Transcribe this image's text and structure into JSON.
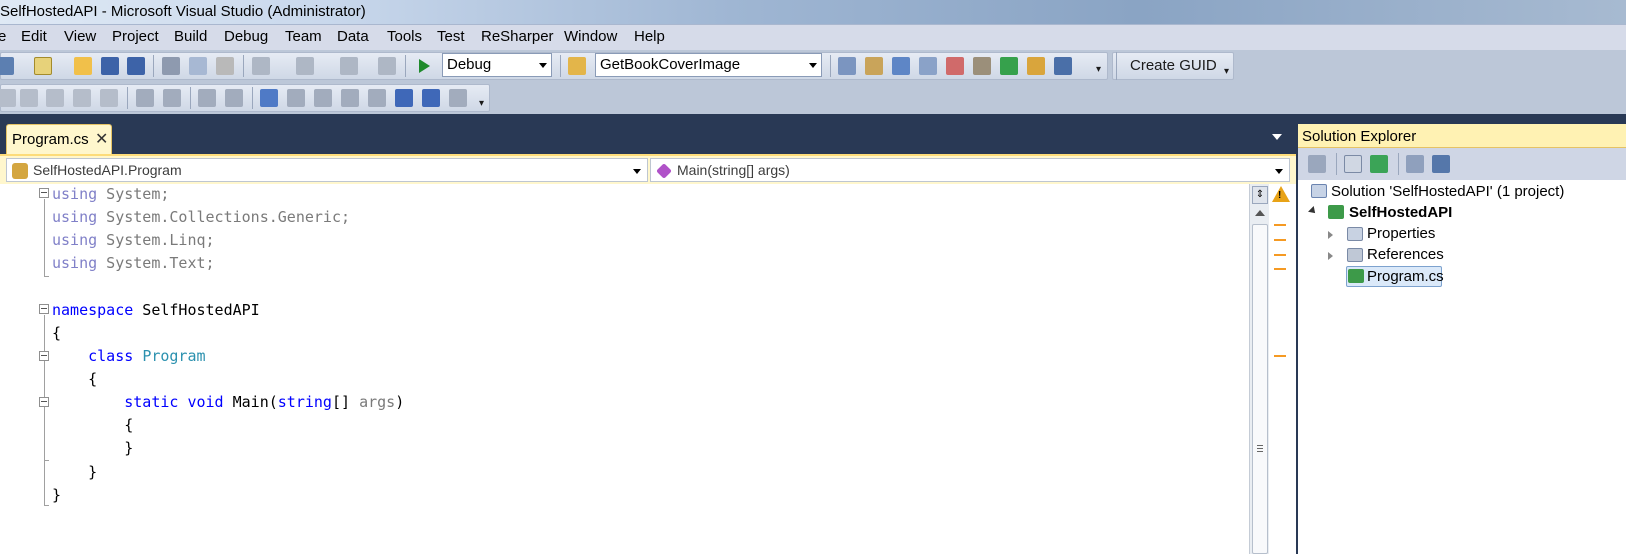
{
  "window": {
    "title": "SelfHostedAPI - Microsoft Visual Studio (Administrator)"
  },
  "menu": [
    "e",
    "Edit",
    "View",
    "Project",
    "Build",
    "Debug",
    "Team",
    "Data",
    "Tools",
    "Test",
    "ReSharper",
    "Window",
    "Help"
  ],
  "toolbar": {
    "configuration": "Debug",
    "find_combo": "GetBookCoverImage",
    "create_guid": "Create GUID"
  },
  "document": {
    "tab_label": "Program.cs",
    "tab_close": "✕"
  },
  "navbar": {
    "type_combo": "SelfHostedAPI.Program",
    "member_combo": "Main(string[] args)"
  },
  "code": {
    "l1_kw": "using",
    "l1_rest": " System;",
    "l2_kw": "using",
    "l2_rest": " System.Collections.Generic;",
    "l3_kw": "using",
    "l3_rest": " System.Linq;",
    "l4_kw": "using",
    "l4_rest": " System.Text;",
    "l6_kw": "namespace",
    "l6_rest": " SelfHostedAPI",
    "l7": "{",
    "l8_indent": "    ",
    "l8_kw": "class",
    "l8_sp": " ",
    "l8_type": "Program",
    "l9": "    {",
    "l10_indent": "        ",
    "l10_kw1": "static",
    "l10_sp1": " ",
    "l10_kw2": "void",
    "l10_name": " Main(",
    "l10_kw3": "string",
    "l10_br": "[] ",
    "l10_arg": "args",
    "l10_end": ")",
    "l11": "        {",
    "l12": "        }",
    "l13": "    }",
    "l14": "}"
  },
  "solution_explorer": {
    "title": "Solution Explorer",
    "solution": "Solution 'SelfHostedAPI' (1 project)",
    "project": "SelfHostedAPI",
    "items": [
      "Properties",
      "References",
      "Program.cs"
    ]
  }
}
